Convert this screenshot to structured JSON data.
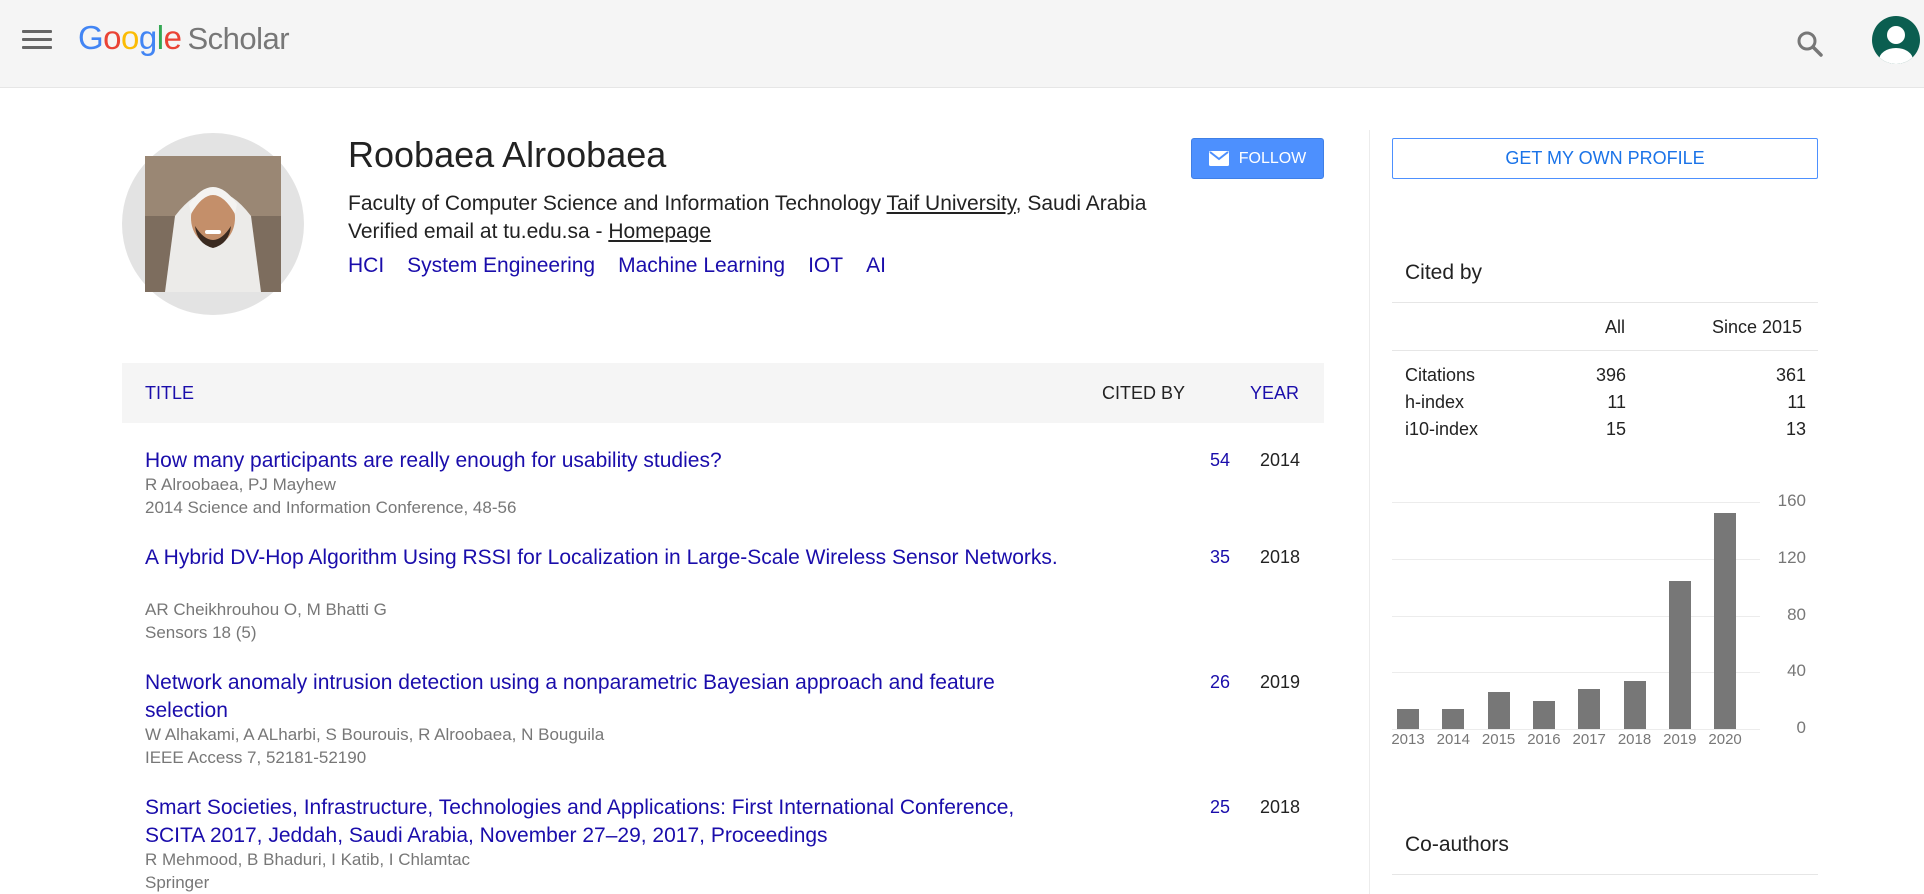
{
  "header": {
    "logo_letters": [
      "G",
      "o",
      "o",
      "g",
      "l",
      "e"
    ],
    "logo_product": "Scholar",
    "menu_icon": "hamburger-menu-icon",
    "search_icon": "search-icon",
    "account_icon": "account-avatar-icon"
  },
  "profile": {
    "name": "Roobaea Alroobaea",
    "affiliation_prefix": "Faculty of Computer Science and Information Technology ",
    "affiliation_link": "Taif University",
    "affiliation_suffix": ", Saudi Arabia",
    "email_text": "Verified email at tu.edu.sa - ",
    "homepage_link": "Homepage",
    "interests": [
      "HCI",
      "System Engineering",
      "Machine Learning",
      "IOT",
      "AI"
    ],
    "follow_label": "FOLLOW"
  },
  "table": {
    "col_title": "TITLE",
    "col_cited": "CITED BY",
    "col_year": "YEAR",
    "rows": [
      {
        "title": "How many participants are really enough for usability studies?",
        "authors": "R Alroobaea, PJ Mayhew",
        "venue": "2014 Science and Information Conference, 48-56",
        "cited": "54",
        "year": "2014"
      },
      {
        "title": "A Hybrid DV-Hop Algorithm Using RSSI for Localization in Large-Scale Wireless Sensor Networks.",
        "authors": "AR Cheikhrouhou O, M Bhatti G",
        "venue": "Sensors 18 (5)",
        "cited": "35",
        "year": "2018"
      },
      {
        "title": "Network anomaly intrusion detection using a nonparametric Bayesian approach and feature selection",
        "authors": "W Alhakami, A ALharbi, S Bourouis, R Alroobaea, N Bouguila",
        "venue": "IEEE Access 7, 52181-52190",
        "cited": "26",
        "year": "2019"
      },
      {
        "title": "Smart Societies, Infrastructure, Technologies and Applications: First International Conference, SCITA 2017, Jeddah, Saudi Arabia, November 27–29, 2017, Proceedings",
        "authors": "R Mehmood, B Bhaduri, I Katib, I Chlamtac",
        "venue": "Springer",
        "cited": "25",
        "year": "2018"
      }
    ]
  },
  "sidebar": {
    "own_profile_label": "GET MY OWN PROFILE",
    "cited_by_heading": "Cited by",
    "stats_headers": [
      "All",
      "Since 2015"
    ],
    "stats": [
      {
        "label": "Citations",
        "all": "396",
        "since": "361"
      },
      {
        "label": "h-index",
        "all": "11",
        "since": "11"
      },
      {
        "label": "i10-index",
        "all": "15",
        "since": "13"
      }
    ],
    "coauthors_heading": "Co-authors"
  },
  "chart_data": {
    "type": "bar",
    "categories": [
      "2013",
      "2014",
      "2015",
      "2016",
      "2017",
      "2018",
      "2019",
      "2020"
    ],
    "values": [
      14,
      14,
      26,
      20,
      28,
      34,
      104,
      152
    ],
    "yticks": [
      "160",
      "120",
      "80",
      "40",
      "0"
    ],
    "ylim": [
      0,
      160
    ],
    "grid": true
  }
}
